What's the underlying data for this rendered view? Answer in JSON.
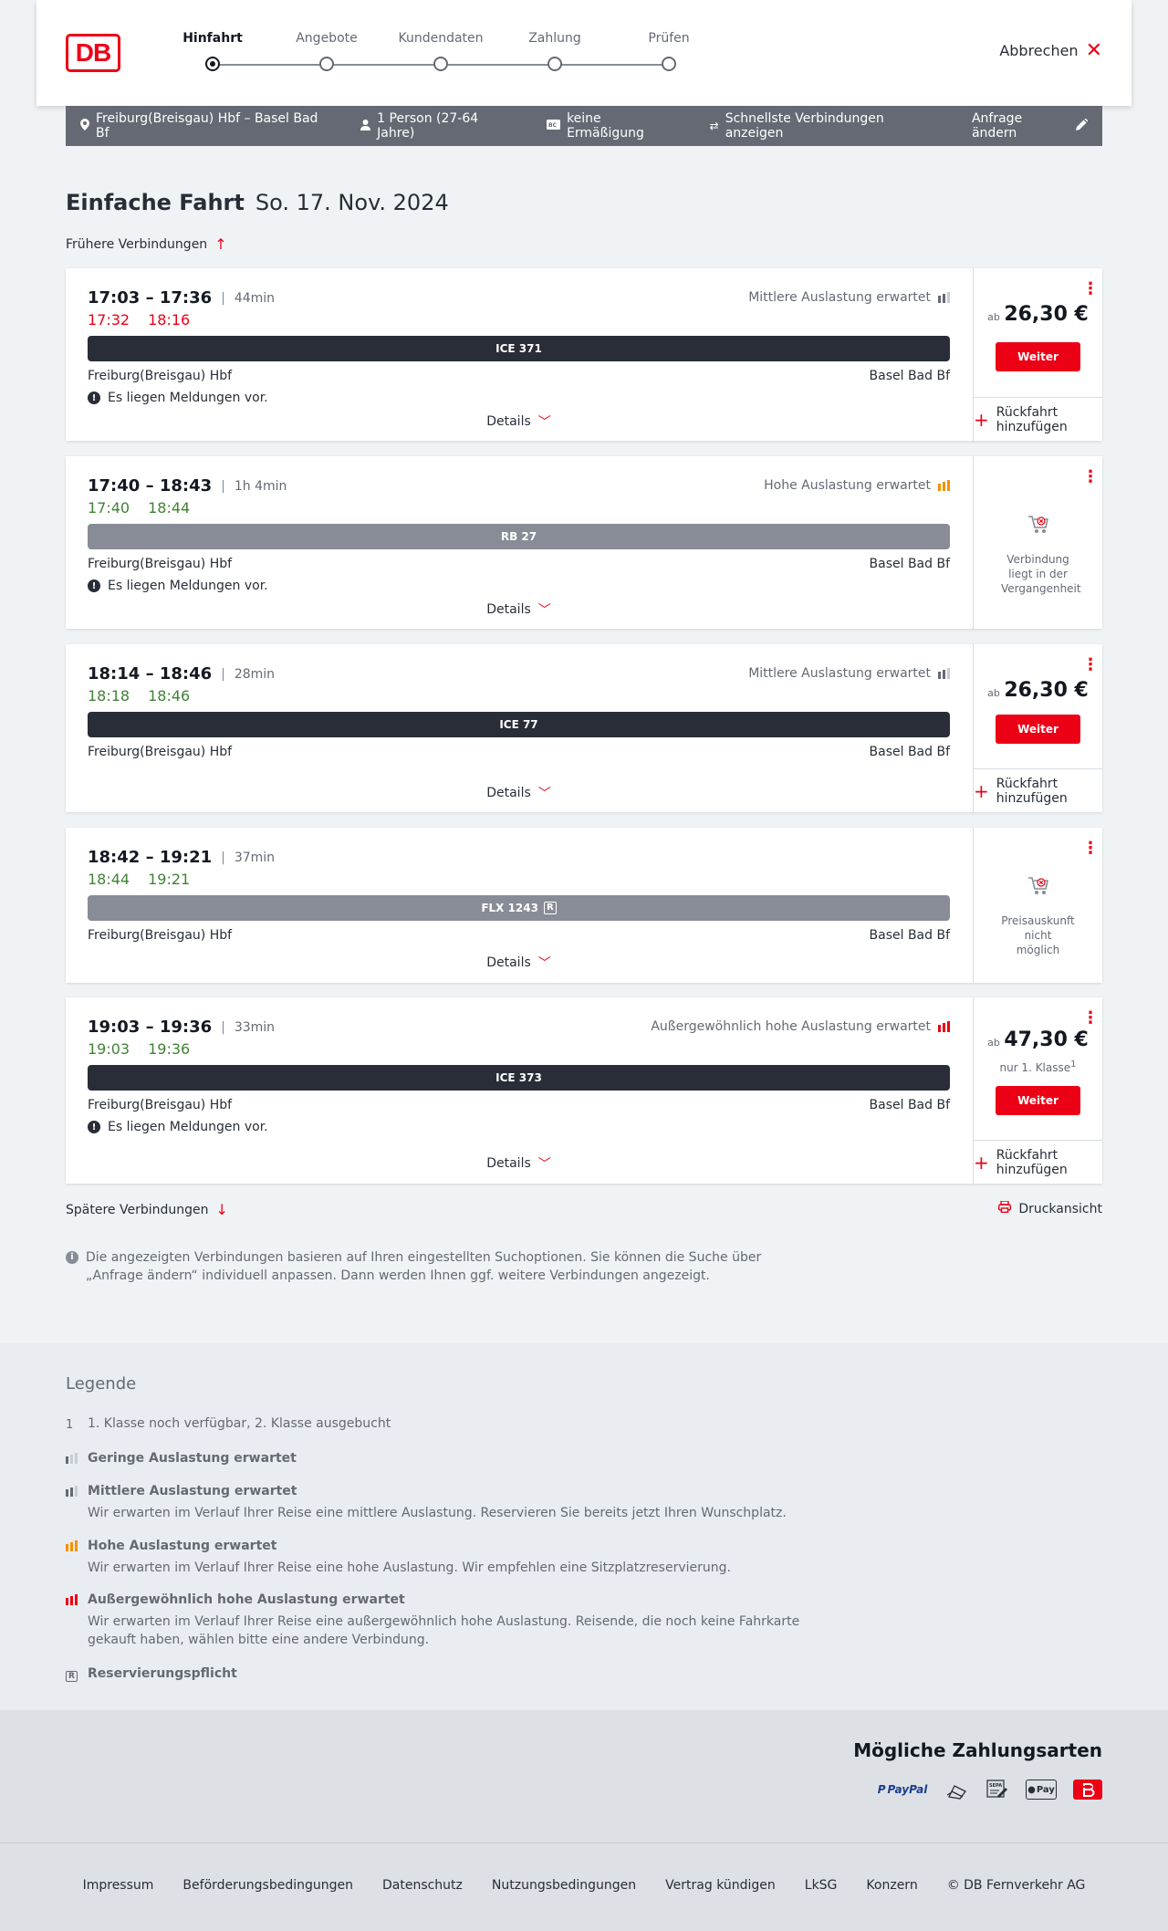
{
  "header": {
    "logo": "DB",
    "steps": [
      "Hinfahrt",
      "Angebote",
      "Kundendaten",
      "Zahlung",
      "Prüfen"
    ],
    "active_step": 0,
    "cancel_label": "Abbrechen"
  },
  "infobar": {
    "route": "Freiburg(Breisgau) Hbf – Basel Bad Bf",
    "passengers": "1 Person (27-64 Jahre)",
    "discount": "keine Ermäßigung",
    "fastest": "Schnellste Verbindungen anzeigen",
    "change": "Anfrage ändern"
  },
  "title": {
    "type": "Einfache Fahrt",
    "date": "So. 17. Nov. 2024"
  },
  "earlier_label": "Frühere Verbindungen",
  "later_label": "Spätere Verbindungen",
  "print_label": "Druckansicht",
  "connections": [
    {
      "times": "17:03 – 17:36",
      "duration": "44min",
      "rt_dep": "17:32",
      "rt_arr": "18:16",
      "rt_color": "red",
      "load": "Mittlere Auslastung erwartet",
      "load_level": "mid",
      "train": "ICE 371",
      "bar": "dark",
      "from": "Freiburg(Breisgau) Hbf",
      "to": "Basel Bad Bf",
      "notice": "Es liegen Meldungen vor.",
      "details": "Details",
      "price_prefix": "ab",
      "price": "26,30 €",
      "button": "Weiter",
      "return_label": "Rückfahrt hinzufügen"
    },
    {
      "times": "17:40 – 18:43",
      "duration": "1h 4min",
      "rt_dep": "17:40",
      "rt_arr": "18:44",
      "rt_color": "green",
      "load": "Hohe Auslastung erwartet",
      "load_level": "high",
      "train": "RB 27",
      "bar": "grey",
      "from": "Freiburg(Breisgau) Hbf",
      "to": "Basel Bad Bf",
      "notice": "Es liegen Meldungen vor.",
      "details": "Details",
      "unavailable": "Verbindung liegt in der Vergangenheit"
    },
    {
      "times": "18:14 – 18:46",
      "duration": "28min",
      "rt_dep": "18:18",
      "rt_arr": "18:46",
      "rt_color": "green",
      "load": "Mittlere Auslastung erwartet",
      "load_level": "mid",
      "train": "ICE 77",
      "bar": "dark",
      "from": "Freiburg(Breisgau) Hbf",
      "to": "Basel Bad Bf",
      "details": "Details",
      "price_prefix": "ab",
      "price": "26,30 €",
      "button": "Weiter",
      "return_label": "Rückfahrt hinzufügen"
    },
    {
      "times": "18:42 – 19:21",
      "duration": "37min",
      "rt_dep": "18:44",
      "rt_arr": "19:21",
      "rt_color": "green",
      "train": "FLX 1243",
      "train_badge": "R",
      "bar": "grey",
      "from": "Freiburg(Breisgau) Hbf",
      "to": "Basel Bad Bf",
      "details": "Details",
      "unavailable": "Preisauskunft nicht möglich"
    },
    {
      "times": "19:03 – 19:36",
      "duration": "33min",
      "rt_dep": "19:03",
      "rt_arr": "19:36",
      "rt_color": "green",
      "load": "Außergewöhnlich hohe Auslastung erwartet",
      "load_level": "extreme",
      "train": "ICE 373",
      "bar": "dark",
      "from": "Freiburg(Breisgau) Hbf",
      "to": "Basel Bad Bf",
      "notice": "Es liegen Meldungen vor.",
      "details": "Details",
      "price_prefix": "ab",
      "price": "47,30 €",
      "price_note": "nur 1. Klasse",
      "price_note_sup": "1",
      "button": "Weiter",
      "return_label": "Rückfahrt hinzufügen"
    }
  ],
  "info_note": "Die angezeigten Verbindungen basieren auf Ihren eingestellten Suchoptionen. Sie können die Suche über „Anfrage ändern“ individuell anpassen. Dann werden Ihnen ggf. weitere Verbindungen angezeigt.",
  "legend": {
    "title": "Legende",
    "footnote_key": "1",
    "footnote": "1. Klasse noch verfügbar, 2. Klasse ausgebucht",
    "low": "Geringe Auslastung erwartet",
    "mid": "Mittlere Auslastung erwartet",
    "mid_desc": "Wir erwarten im Verlauf Ihrer Reise eine mittlere Auslastung. Reservieren Sie bereits jetzt Ihren Wunschplatz.",
    "high": "Hohe Auslastung erwartet",
    "high_desc": "Wir erwarten im Verlauf Ihrer Reise eine hohe Auslastung. Wir empfehlen eine Sitzplatzreservierung.",
    "extreme": "Außergewöhnlich hohe Auslastung erwartet",
    "extreme_desc": "Wir erwarten im Verlauf Ihrer Reise eine außergewöhnlich hohe Auslastung. Reisende, die noch keine Fahrkarte gekauft haben, wählen bitte eine andere Verbindung.",
    "reservation": "Reservierungspflicht"
  },
  "payment": {
    "title": "Mögliche Zahlungsarten",
    "methods": [
      "paypal-icon",
      "credit-card-icon",
      "sepa-icon",
      "apple-pay-icon",
      "bahnbonus-icon"
    ],
    "paypal": "PayPal",
    "sepa": "SEPA",
    "applepay": "Pay"
  },
  "footer": [
    "Impressum",
    "Beförderungsbedingungen",
    "Datenschutz",
    "Nutzungsbedingungen",
    "Vertrag kündigen",
    "LkSG",
    "Konzern",
    "© DB Fernverkehr AG"
  ],
  "colors": {
    "db_red": "#ec0016",
    "dark": "#282d37",
    "green": "#408335",
    "grey_bar": "#878c96",
    "high_load": "#f39200"
  }
}
